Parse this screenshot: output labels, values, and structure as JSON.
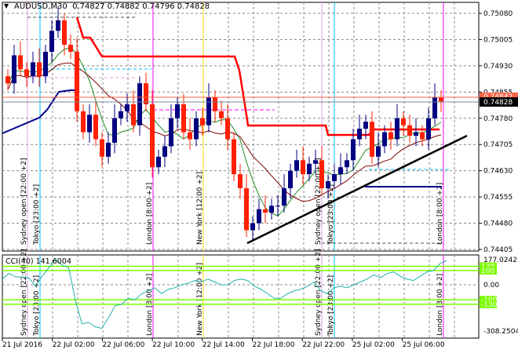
{
  "header": {
    "symbol": "AUDUSD,M30",
    "open": "0.74827",
    "high": "0.74882",
    "low": "0.74796",
    "close": "0.74828"
  },
  "price_axis": [
    "0.75080",
    "0.75005",
    "0.74930",
    "0.74855",
    "0.74780",
    "0.74705",
    "0.74630",
    "0.74555",
    "0.74480",
    "0.74405"
  ],
  "price_markers": {
    "alert_line": "0.74842",
    "bid": "0.74828"
  },
  "time_axis": [
    "21 Jul 2016",
    "22 Jul 02:00",
    "22 Jul 06:00",
    "22 Jul 10:00",
    "22 Jul 14:00",
    "22 Jul 18:00",
    "22 Jul 22:00",
    "25 Jul 02:00",
    "25 Jul 06:00"
  ],
  "sessions_main": [
    "Sydney open  [22:00 +2]",
    "Tokyo  [23:00 +2]",
    "London  [8:00 +2]",
    "New York  [12:00 +2]",
    "Sydney open  [22:00 +2]",
    "Tokyo  [23:00 +2]",
    "London  [8:00 +2]"
  ],
  "sessions_cci": [
    "Sydney open  [22:00 +2]",
    "Tokyo  [23:00 +2]",
    "London  [3:00 +2]",
    "New York  [12:00 +2]",
    "Sydney open  [22:00 +2]",
    "Tokyo  [23:00 +2]",
    "London  [3:00 +2]"
  ],
  "cci": {
    "title": "CCI(40) 141.6004",
    "axis_max": "177.0242",
    "axis_zero": "0.00",
    "axis_min": "-308.2504",
    "levels": [
      "130",
      "100",
      "-100",
      "-130"
    ],
    "values": [
      40,
      80,
      55,
      55,
      48,
      -10,
      60,
      120,
      177,
      140,
      120,
      -100,
      -260,
      -250,
      -280,
      -290,
      -220,
      -140,
      -130,
      -90,
      -100,
      -60,
      -40,
      -20,
      -60,
      -30,
      -20,
      0,
      10,
      30,
      20,
      40,
      20,
      0,
      0,
      30,
      40,
      30,
      -10,
      -30,
      -60,
      -90,
      -90,
      -60,
      -40,
      -30,
      -10,
      20,
      -40,
      -60,
      -20,
      -10,
      -20,
      0,
      20,
      40,
      70,
      50,
      80,
      90,
      60,
      40,
      30,
      60,
      90,
      100,
      150,
      170
    ],
    "line_color": "#20b2aa"
  },
  "candles_close": [
    0.7488,
    0.7496,
    0.7492,
    0.749,
    0.7494,
    0.749,
    0.7497,
    0.7503,
    0.7506,
    0.7499,
    0.7497,
    0.748,
    0.7474,
    0.7479,
    0.7472,
    0.7467,
    0.7471,
    0.7478,
    0.748,
    0.7482,
    0.7476,
    0.7488,
    0.7482,
    0.7464,
    0.7467,
    0.747,
    0.7478,
    0.7482,
    0.7474,
    0.7472,
    0.7478,
    0.7476,
    0.7484,
    0.748,
    0.7478,
    0.7472,
    0.7462,
    0.7458,
    0.7446,
    0.7448,
    0.7452,
    0.7451,
    0.7453,
    0.7453,
    0.7458,
    0.7463,
    0.7466,
    0.7462,
    0.7465,
    0.7466,
    0.7458,
    0.746,
    0.7462,
    0.7464,
    0.7466,
    0.7472,
    0.7475,
    0.7477,
    0.7467,
    0.747,
    0.7474,
    0.7472,
    0.7478,
    0.7476,
    0.7473,
    0.7474,
    0.7472,
    0.7478,
    0.7484,
    0.74828
  ],
  "colors": {
    "bull": "#000080",
    "bear": "#ff2000",
    "stop_line": "#ff0000",
    "ma_fast": "#228b22",
    "ma_slow": "#800000",
    "level_green": "#7cfc00",
    "bid_bg": "#000000",
    "alert_bg": "#ff6347"
  }
}
